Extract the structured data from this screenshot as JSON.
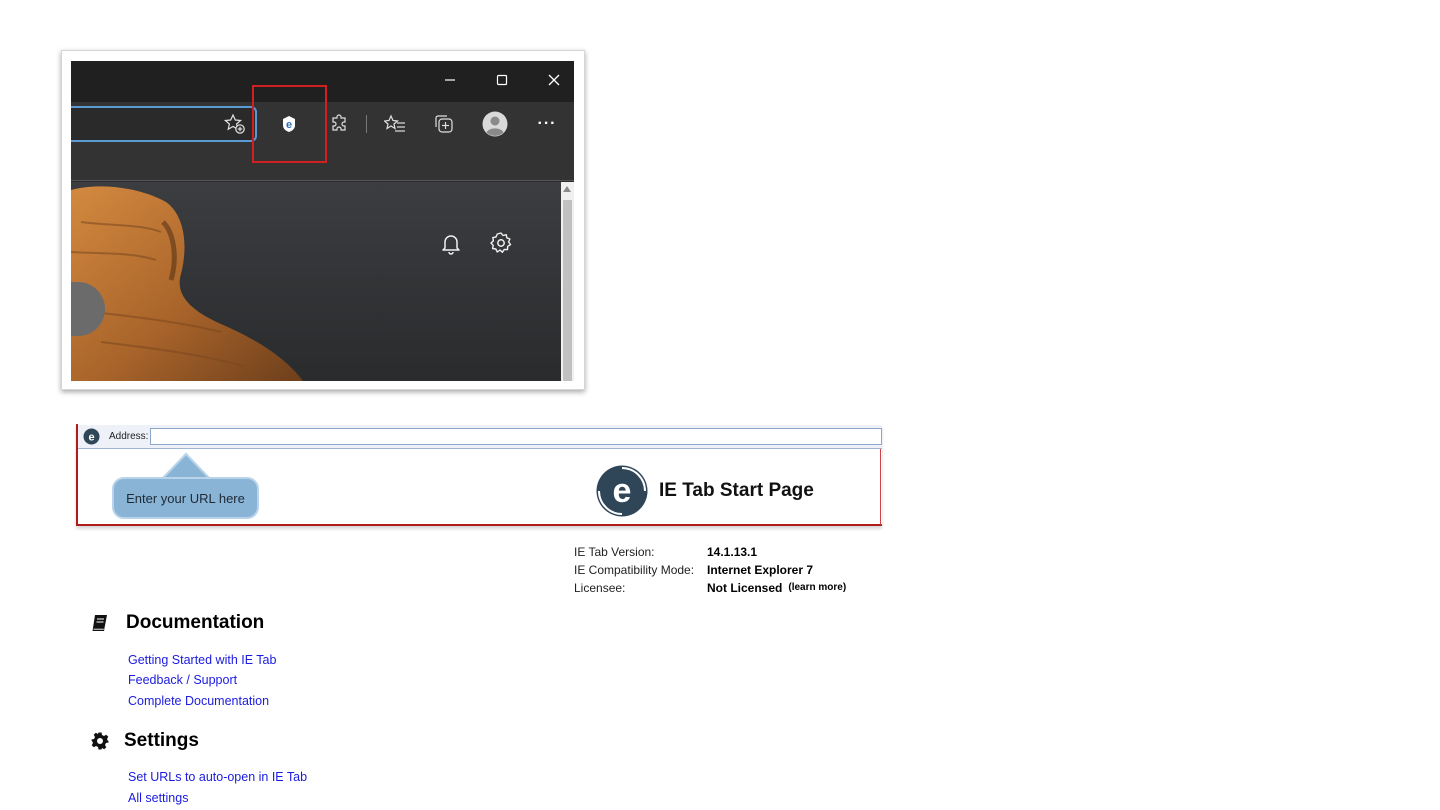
{
  "browser_window": {
    "caption_buttons": {
      "minimize": "—",
      "maximize": "□",
      "close": "✕"
    },
    "toolbar_icons": [
      "add-favorite-icon",
      "ie-tab-extension-icon",
      "extensions-icon",
      "favorites-icon",
      "collections-icon",
      "profile-icon",
      "more-icon"
    ],
    "more_label": "···",
    "content_icons": [
      "bell-icon",
      "gear-icon"
    ],
    "highlight_color": "#d21f1f"
  },
  "ie_tab": {
    "address_label": "Address:",
    "address_value": "",
    "callout_text": "Enter your URL here",
    "title": "IE Tab Start Page"
  },
  "info": {
    "version_label": "IE Tab Version:",
    "version_value": "14.1.13.1",
    "compat_label": "IE Compatibility Mode:",
    "compat_value": "Internet Explorer 7",
    "licensee_label": "Licensee:",
    "licensee_value": "Not Licensed",
    "learn_more": "(learn more)"
  },
  "documentation": {
    "title": "Documentation",
    "links": [
      "Getting Started with IE Tab",
      "Feedback / Support",
      "Complete Documentation"
    ]
  },
  "settings": {
    "title": "Settings",
    "links": [
      "Set URLs to auto-open in IE Tab",
      "All settings"
    ]
  },
  "colors": {
    "link": "#1b1be0",
    "accent_red": "#b01c1c",
    "callout": "#8ab4d6",
    "ie_logo": "#2f4558"
  }
}
